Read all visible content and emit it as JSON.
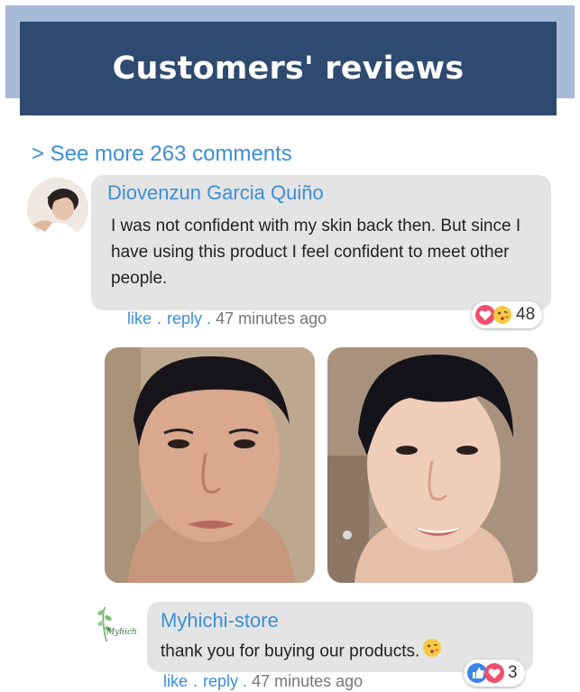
{
  "header": {
    "title": "Customers' reviews"
  },
  "see_more": "> See more 263 comments",
  "comments": [
    {
      "author": "Diovenzun Garcia Quiño",
      "text": "I was not confident with my skin back then. But since I have using this product I feel confident to meet other people.",
      "actions": {
        "like": "like",
        "sep": ".",
        "reply": "reply .",
        "time": "47 minutes ago"
      },
      "reactions": {
        "icons": [
          "heart-icon",
          "kiss-emoji-icon"
        ],
        "count": "48"
      }
    },
    {
      "author": "Myhichi-store",
      "avatar_logo_text": "Myhichi",
      "text": "thank you for buying our products.",
      "actions": {
        "like": "like",
        "sep": ".",
        "reply": "reply .",
        "time": "47 minutes ago"
      },
      "reactions": {
        "icons": [
          "thumbs-up-icon",
          "heart-icon"
        ],
        "count": "3"
      }
    }
  ],
  "photos": [
    "before-photo",
    "after-photo"
  ],
  "colors": {
    "header_bg": "#2f4a70",
    "header_frame": "#a7bbd9",
    "link": "#3b8fd9",
    "bubble": "#e4e4e4"
  }
}
